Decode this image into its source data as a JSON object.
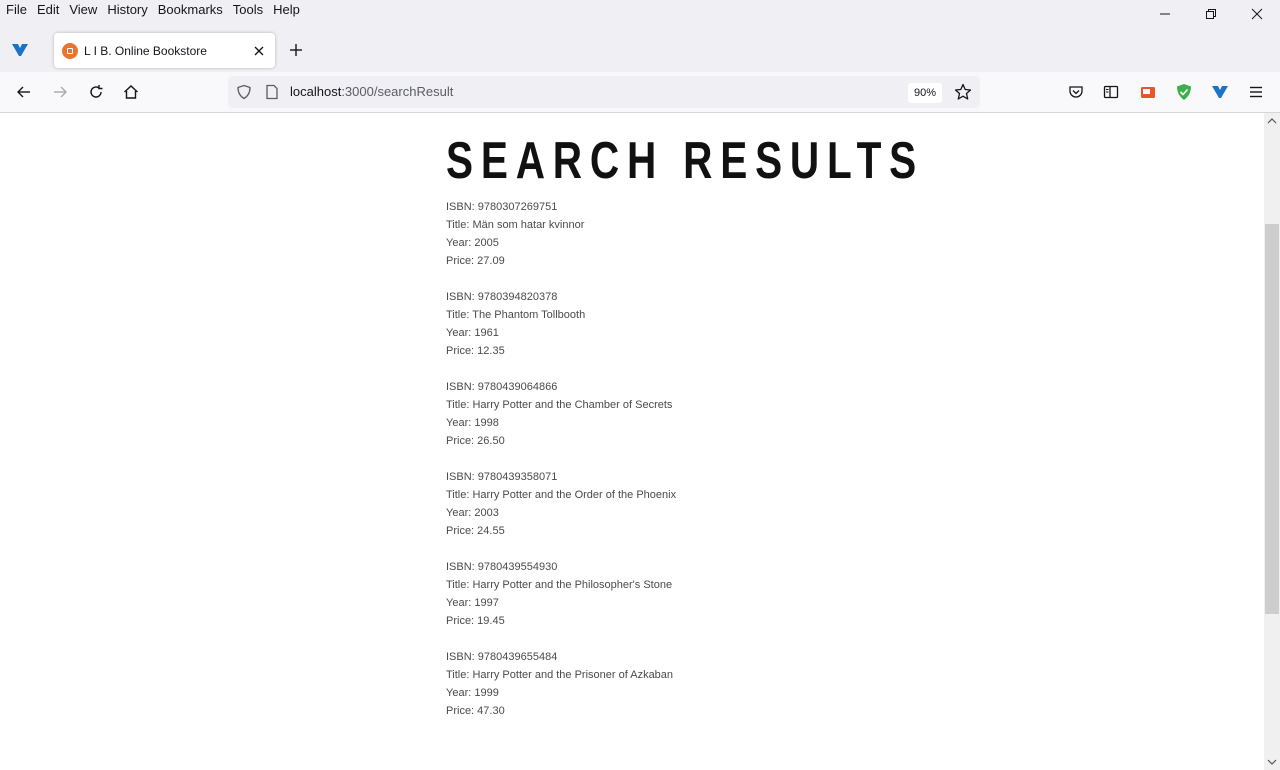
{
  "menu": [
    "File",
    "Edit",
    "View",
    "History",
    "Bookmarks",
    "Tools",
    "Help"
  ],
  "tab": {
    "title": "L I B. Online Bookstore"
  },
  "url": {
    "host": "localhost",
    "path": ":3000/searchResult"
  },
  "zoom": "90%",
  "page": {
    "title": "SEARCH RESULTS",
    "books": [
      {
        "isbn": "ISBN: 9780307269751",
        "title": "Title: Män som hatar kvinnor",
        "year": "Year: 2005",
        "price": "Price: 27.09"
      },
      {
        "isbn": "ISBN: 9780394820378",
        "title": "Title: The Phantom Tollbooth",
        "year": "Year: 1961",
        "price": "Price: 12.35"
      },
      {
        "isbn": "ISBN: 9780439064866",
        "title": "Title: Harry Potter and the Chamber of Secrets",
        "year": "Year: 1998",
        "price": "Price: 26.50"
      },
      {
        "isbn": "ISBN: 9780439358071",
        "title": "Title: Harry Potter and the Order of the Phoenix",
        "year": "Year: 2003",
        "price": "Price: 24.55"
      },
      {
        "isbn": "ISBN: 9780439554930",
        "title": "Title: Harry Potter and the Philosopher's Stone",
        "year": "Year: 1997",
        "price": "Price: 19.45"
      },
      {
        "isbn": "ISBN: 9780439655484",
        "title": "Title: Harry Potter and the Prisoner of Azkaban",
        "year": "Year: 1999",
        "price": "Price: 47.30"
      }
    ]
  },
  "icons": {
    "pinned": "tab-pin-icon",
    "favicon": "bookstore-favicon-icon",
    "close": "close-icon",
    "back": "back-arrow-icon",
    "forward": "forward-arrow-icon",
    "reload": "reload-icon",
    "home": "home-icon",
    "shield": "shield-icon",
    "page": "page-icon",
    "star": "star-icon",
    "pocket": "pocket-icon",
    "reader": "sidebar-icon",
    "ext": "extension-icon",
    "menu": "hamburger-menu-icon"
  }
}
